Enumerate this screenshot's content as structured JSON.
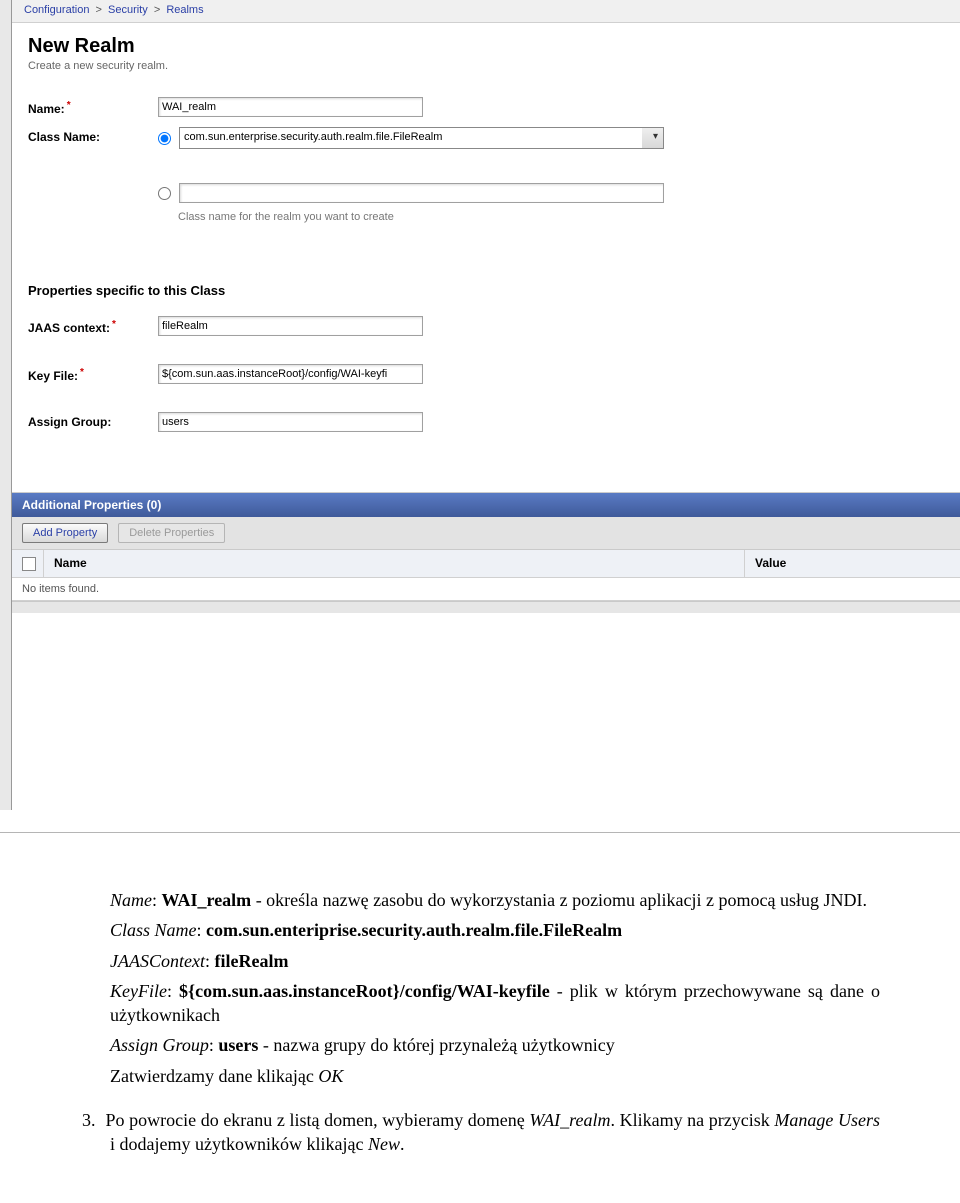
{
  "breadcrumb": {
    "item1": "Configuration",
    "item2": "Security",
    "item3": "Realms"
  },
  "page": {
    "title": "New Realm",
    "subtitle": "Create a new security realm."
  },
  "form": {
    "name_label": "Name:",
    "name_value": "WAI_realm",
    "class_name_label": "Class Name:",
    "class_select_value": "com.sun.enterprise.security.auth.realm.file.FileRealm",
    "class_text_value": "",
    "class_help": "Class name for the realm you want to create"
  },
  "props_section": {
    "heading": "Properties specific to this Class",
    "jaas_label": "JAAS context:",
    "jaas_value": "fileRealm",
    "keyfile_label": "Key File:",
    "keyfile_value": "${com.sun.aas.instanceRoot}/config/WAI-keyfi",
    "assign_group_label": "Assign Group:",
    "assign_group_value": "users"
  },
  "table": {
    "header": "Additional Properties (0)",
    "add_btn": "Add Property",
    "delete_btn": "Delete Properties",
    "col_name": "Name",
    "col_value": "Value",
    "empty": "No items found."
  },
  "doc": {
    "p1a": "Name",
    "p1b": ": ",
    "p1c": "WAI_realm",
    "p1d": " - określa nazwę zasobu do wykorzystania z poziomu aplikacji z pomocą usług JNDI.",
    "p2a": "Class Name",
    "p2b": ": ",
    "p2c": "com.sun.enteriprise.security.auth.realm.file.FileRealm",
    "p3a": "JAASContext",
    "p3b": ": ",
    "p3c": "fileRealm",
    "p4a": "KeyFile",
    "p4b": ": ",
    "p4c": "${com.sun.aas.instanceRoot}/config/WAI-keyfile",
    "p4d": " - plik w którym przechowywane są dane o użytkownikach",
    "p5a": "Assign Group",
    "p5b": ": ",
    "p5c": "users",
    "p5d": " - nazwa grupy do której przynależą użytkownicy",
    "p6": "Zatwierdzamy dane klikając ",
    "p6b": "OK",
    "li_num": "3.",
    "li_text_a": "Po powrocie do ekranu z listą domen, wybieramy domenę ",
    "li_text_b": "WAI_realm",
    "li_text_c": ". Klikamy na przycisk ",
    "li_text_d": "Manage Users",
    "li_text_e": " i dodajemy użytkowników klikając ",
    "li_text_f": "New",
    "li_text_g": "."
  }
}
